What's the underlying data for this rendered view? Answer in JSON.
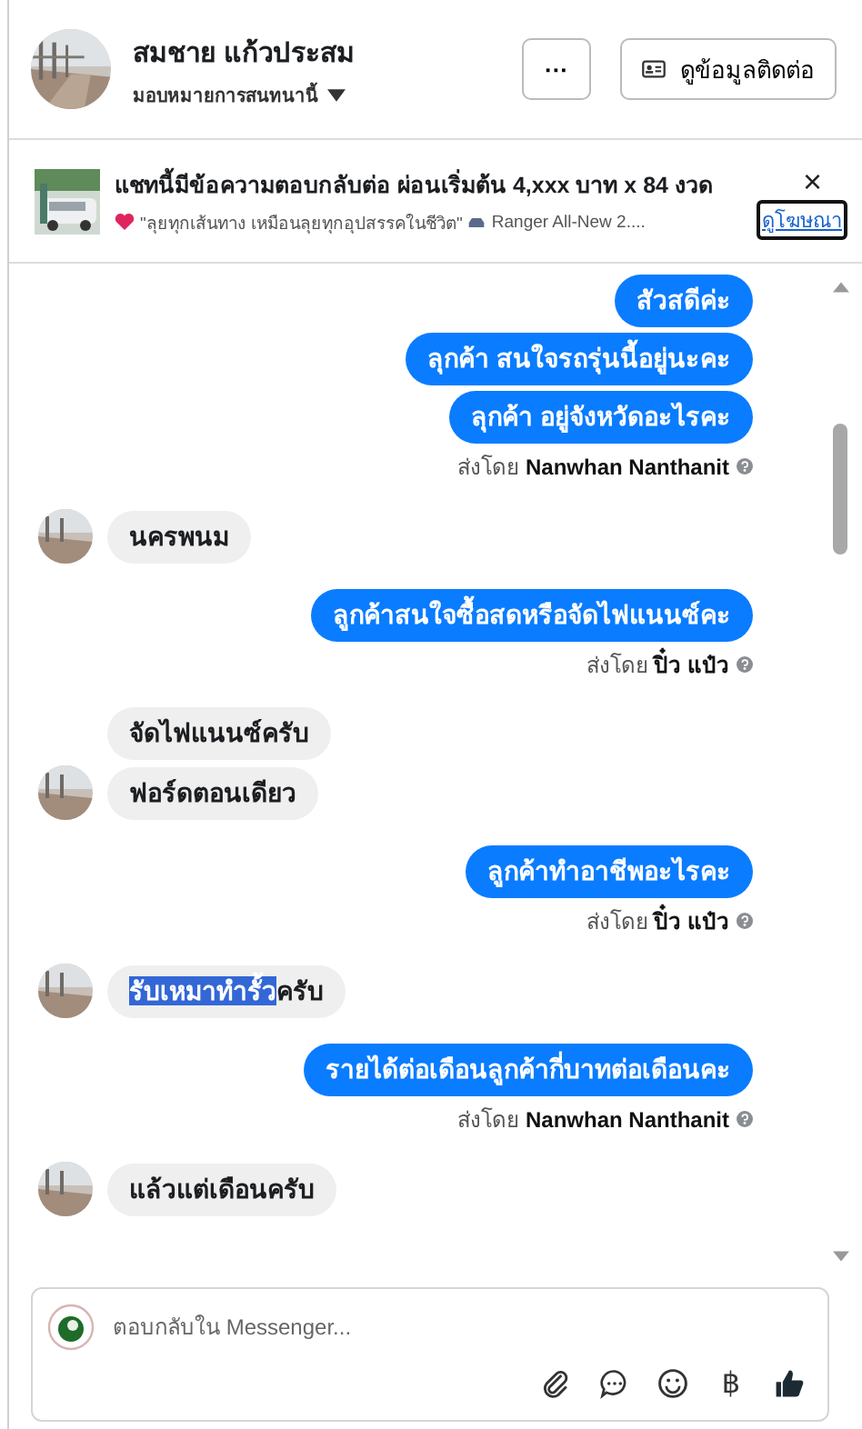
{
  "header": {
    "name": "สมชาย แก้วประสม",
    "assign_label": "มอบหมายการสนทนานี้",
    "more_button": "···",
    "contact_button": "ดูข้อมูลติดต่อ"
  },
  "ad": {
    "title": "แชทนี้มีข้อความตอบกลับต่อ ผ่อนเริ่มต้น 4,xxx บาท x 84 งวด",
    "subtitle": "\"ลุยทุกเส้นทาง เหมือนลุยทุกอุปสรรคในชีวิต\"",
    "subtitle_more": "Ranger All-New 2....",
    "link": "ดูโฆษณา",
    "close": "×"
  },
  "messages": [
    {
      "kind": "outgoing",
      "bubbles": [
        {
          "text": "สัวสดีค่ะ"
        },
        {
          "text": "ลุกค้า สนใจรถรุ่นนี้อยู่นะคะ"
        },
        {
          "text": "ลุกค้า อยู่จังหวัดอะไรคะ"
        }
      ],
      "sender_prefix": "ส่งโดย",
      "sender": "Nanwhan Nanthanit"
    },
    {
      "kind": "incoming",
      "bubbles": [
        {
          "text": "นครพนม"
        }
      ]
    },
    {
      "kind": "outgoing",
      "bubbles": [
        {
          "text": "ลูกค้าสนใจซื้อสดหรือจัดไฟแนนซ์คะ"
        }
      ],
      "sender_prefix": "ส่งโดย",
      "sender": "ปิ๋ว แป๋ว"
    },
    {
      "kind": "incoming",
      "bubbles": [
        {
          "text": "จัดไฟแนนซ์ครับ"
        },
        {
          "text": "ฟอร์ดตอนเดียว"
        }
      ]
    },
    {
      "kind": "outgoing",
      "bubbles": [
        {
          "text": "ลูกค้าทำอาชีพอะไรคะ"
        }
      ],
      "sender_prefix": "ส่งโดย",
      "sender": "ปิ๋ว แป๋ว"
    },
    {
      "kind": "incoming",
      "bubbles": [
        {
          "highlight": "รับเหมาทำรั้ว",
          "text": "ครับ"
        }
      ]
    },
    {
      "kind": "outgoing",
      "bubbles": [
        {
          "text": "รายได้ต่อเดือนลูกค้ากี่บาทต่อเดือนคะ"
        }
      ],
      "sender_prefix": "ส่งโดย",
      "sender": "Nanwhan Nanthanit"
    },
    {
      "kind": "incoming",
      "bubbles": [
        {
          "text": "แล้วแต่เดือนครับ"
        }
      ]
    }
  ],
  "composer": {
    "placeholder": "ตอบกลับใน Messenger...",
    "currency": "฿"
  }
}
